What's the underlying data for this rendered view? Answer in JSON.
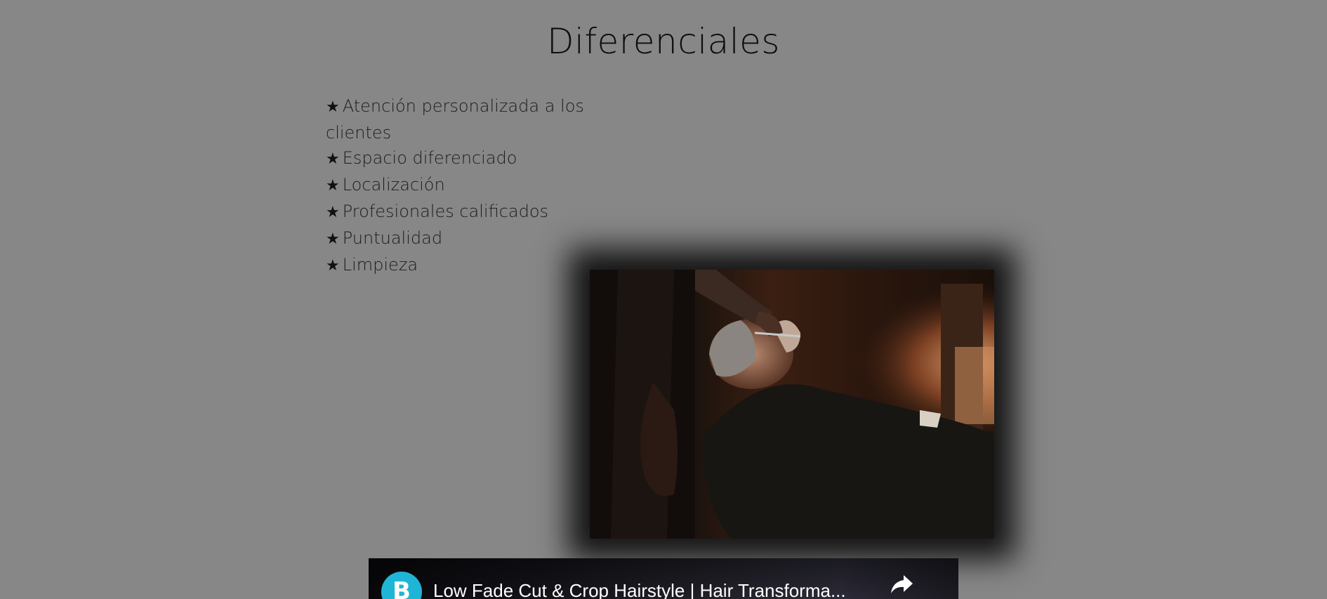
{
  "section": {
    "title": "Diferenciales"
  },
  "features": {
    "bullet_icon": "star-icon",
    "bullet_glyph": "★",
    "items": [
      "Atención personalizada a los clientes",
      "Espacio diferenciado",
      "Localización",
      "Profesionales calificados",
      "Puntualidad",
      "Limpieza"
    ]
  },
  "video": {
    "title": "Low Fade Cut & Crop Hairstyle | Hair Transforma...",
    "channel_logo_letter": "B",
    "channel_logo_color": "#1fb5d6",
    "share_icon": "share-icon"
  },
  "colors": {
    "page_background": "#878787",
    "text": "#111111"
  }
}
